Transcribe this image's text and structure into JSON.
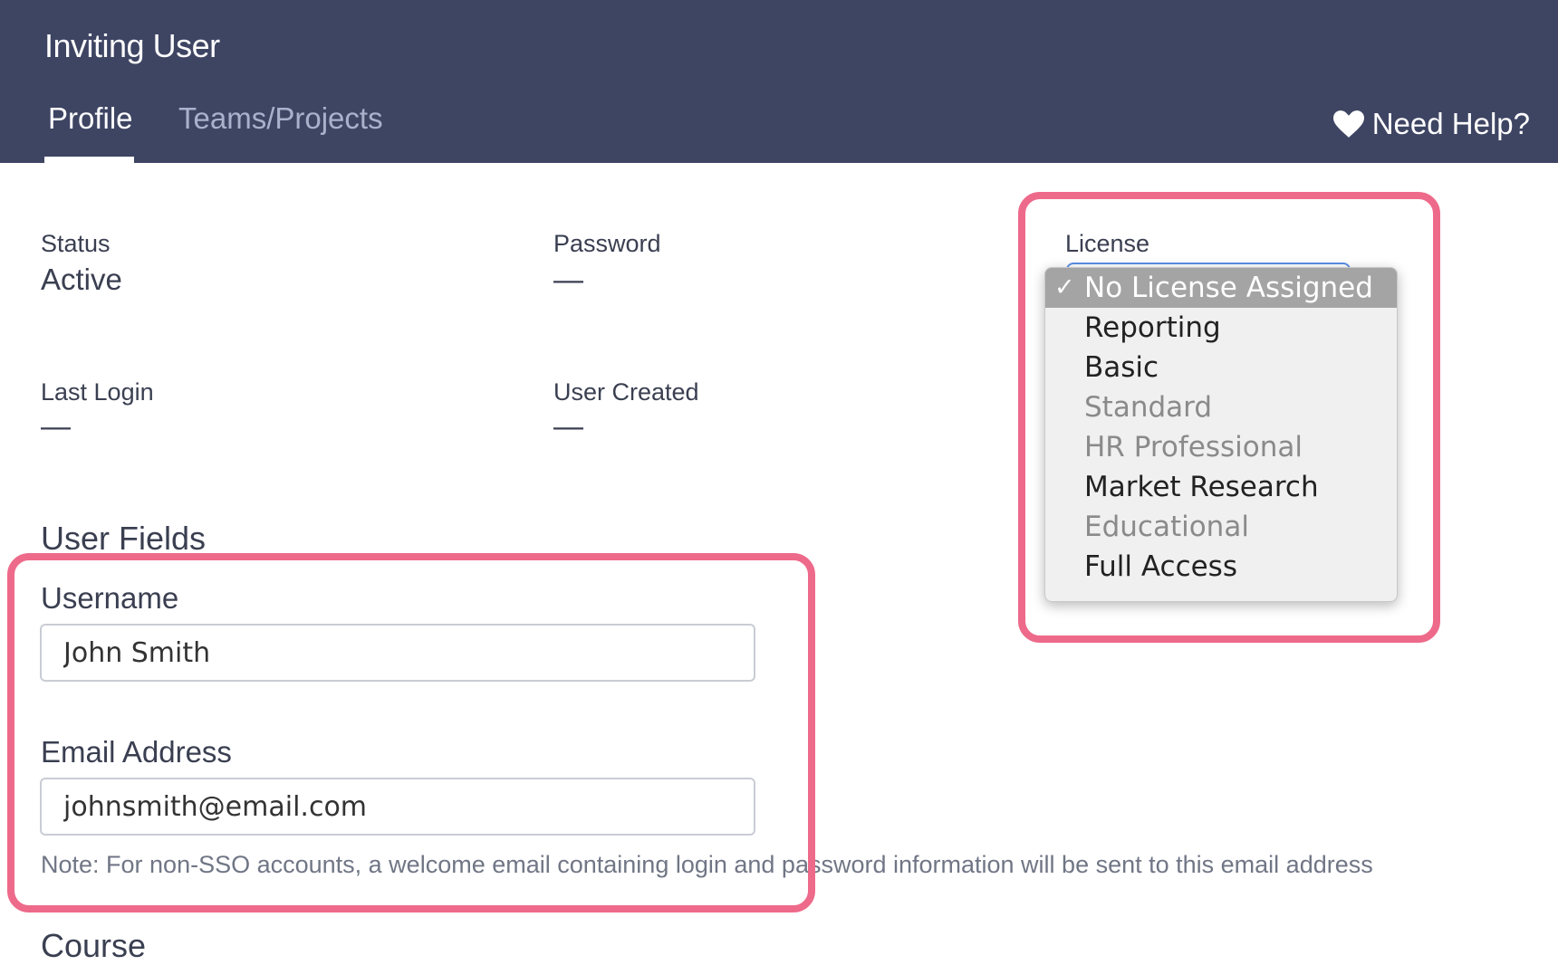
{
  "header": {
    "title": "Inviting User",
    "tabs": [
      {
        "label": "Profile",
        "active": true
      },
      {
        "label": "Teams/Projects",
        "active": false
      }
    ],
    "help_label": "Need Help?",
    "help_icon": "heart-icon",
    "background_color": "#3e4563"
  },
  "profile": {
    "status": {
      "label": "Status",
      "value": "Active"
    },
    "password": {
      "label": "Password",
      "value": "—"
    },
    "last_login": {
      "label": "Last Login",
      "value": "—"
    },
    "user_created": {
      "label": "User Created",
      "value": "—"
    }
  },
  "license": {
    "label": "License",
    "options": [
      {
        "label": "No License Assigned",
        "selected": true,
        "disabled": false
      },
      {
        "label": "Reporting",
        "selected": false,
        "disabled": false
      },
      {
        "label": "Basic",
        "selected": false,
        "disabled": false
      },
      {
        "label": "Standard",
        "selected": false,
        "disabled": true
      },
      {
        "label": "HR Professional",
        "selected": false,
        "disabled": true
      },
      {
        "label": "Market Research",
        "selected": false,
        "disabled": false
      },
      {
        "label": "Educational",
        "selected": false,
        "disabled": true
      },
      {
        "label": "Full Access",
        "selected": false,
        "disabled": false
      }
    ]
  },
  "user_fields": {
    "title": "User Fields",
    "username": {
      "label": "Username",
      "value": "John Smith"
    },
    "email": {
      "label": "Email Address",
      "value": "johnsmith@email.com"
    },
    "note": "Note: For non-SSO accounts, a welcome email containing login and password information will be sent to this email address"
  },
  "next_section_partial": "Course",
  "highlight_color": "#ee6a8a"
}
